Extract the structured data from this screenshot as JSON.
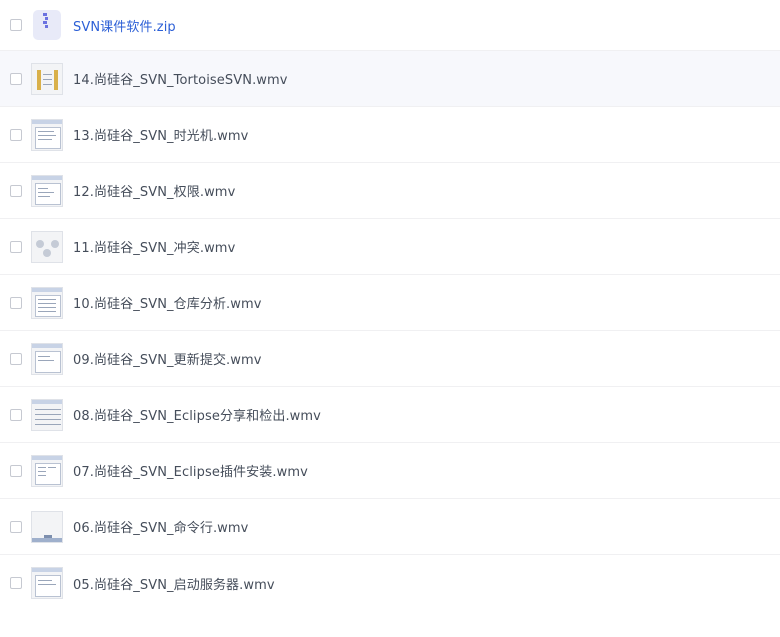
{
  "files": [
    {
      "name": "SVN课件软件.zip",
      "icon": "zip-icon",
      "type": "zip"
    },
    {
      "name": "14.尚硅谷_SVN_TortoiseSVN.wmv",
      "icon": "video-thumbnail",
      "type": "video"
    },
    {
      "name": "13.尚硅谷_SVN_时光机.wmv",
      "icon": "video-thumbnail",
      "type": "video"
    },
    {
      "name": "12.尚硅谷_SVN_权限.wmv",
      "icon": "video-thumbnail",
      "type": "video"
    },
    {
      "name": "11.尚硅谷_SVN_冲突.wmv",
      "icon": "video-thumbnail",
      "type": "video"
    },
    {
      "name": "10.尚硅谷_SVN_仓库分析.wmv",
      "icon": "video-thumbnail",
      "type": "video"
    },
    {
      "name": "09.尚硅谷_SVN_更新提交.wmv",
      "icon": "video-thumbnail",
      "type": "video"
    },
    {
      "name": "08.尚硅谷_SVN_Eclipse分享和检出.wmv",
      "icon": "video-thumbnail",
      "type": "video"
    },
    {
      "name": "07.尚硅谷_SVN_Eclipse插件安装.wmv",
      "icon": "video-thumbnail",
      "type": "video"
    },
    {
      "name": "06.尚硅谷_SVN_命令行.wmv",
      "icon": "video-thumbnail",
      "type": "video"
    },
    {
      "name": "05.尚硅谷_SVN_启动服务器.wmv",
      "icon": "video-thumbnail",
      "type": "video"
    }
  ],
  "colors": {
    "link": "#2c5fd6",
    "text": "#454d5a",
    "hover_row": "#f7f8fc",
    "zip_bg": "#e8eaf8",
    "zip_accent": "#6b72e0"
  }
}
